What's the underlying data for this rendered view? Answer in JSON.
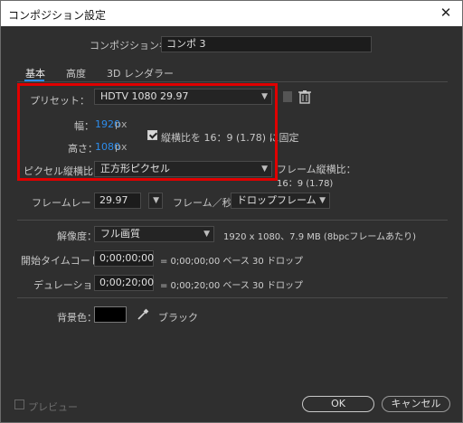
{
  "window": {
    "title": "コンポジション設定",
    "close_glyph": "✕"
  },
  "comp_name": {
    "label": "コンポジション名：",
    "value": "コンポ 3"
  },
  "tabs": [
    {
      "label": "基本",
      "active": true
    },
    {
      "label": "高度",
      "active": false
    },
    {
      "label": "3D レンダラー",
      "active": false
    }
  ],
  "preset": {
    "label": "プリセット：",
    "value": "HDTV 1080 29.97"
  },
  "width": {
    "label": "幅：",
    "value": "1920",
    "unit": "px"
  },
  "height": {
    "label": "高さ：",
    "value": "1080",
    "unit": "px"
  },
  "lock_aspect": {
    "label": "縦横比を 16：9 (1.78) に固定",
    "checked": true
  },
  "pixel_aspect": {
    "label": "ピクセル縦横比：",
    "value": "正方形ピクセル"
  },
  "frame_aspect": {
    "label": "フレーム縦横比：",
    "value": "16：9 (1.78)"
  },
  "frame_rate": {
    "label": "フレームレート：",
    "value": "29.97",
    "unit_label": "フレーム／秒",
    "drop_value": "ドロップフレーム"
  },
  "resolution": {
    "label": "解像度：",
    "value": "フル画質",
    "info": "1920 x 1080、7.9 MB (8bpcフレームあたり)"
  },
  "start_timecode": {
    "label": "開始タイムコード：",
    "value": "0;00;00;00",
    "info": "= 0;00;00;00 ベース 30 ドロップ"
  },
  "duration": {
    "label": "デュレーション：",
    "value": "0;00;20;00",
    "info": "= 0;00;20;00 ベース 30 ドロップ"
  },
  "background": {
    "label": "背景色：",
    "color_name": "ブラック",
    "color": "#000000"
  },
  "preview": {
    "label": "プレビュー",
    "checked": false
  },
  "buttons": {
    "ok": "OK",
    "cancel": "キャンセル"
  },
  "colors": {
    "accent": "#2d8ceb",
    "highlight_box": "#e00000",
    "background": "#2f2f2f"
  },
  "icons": [
    "close-icon",
    "chevron-down-icon",
    "trash-icon",
    "eyedropper-icon",
    "checkmark-icon"
  ]
}
